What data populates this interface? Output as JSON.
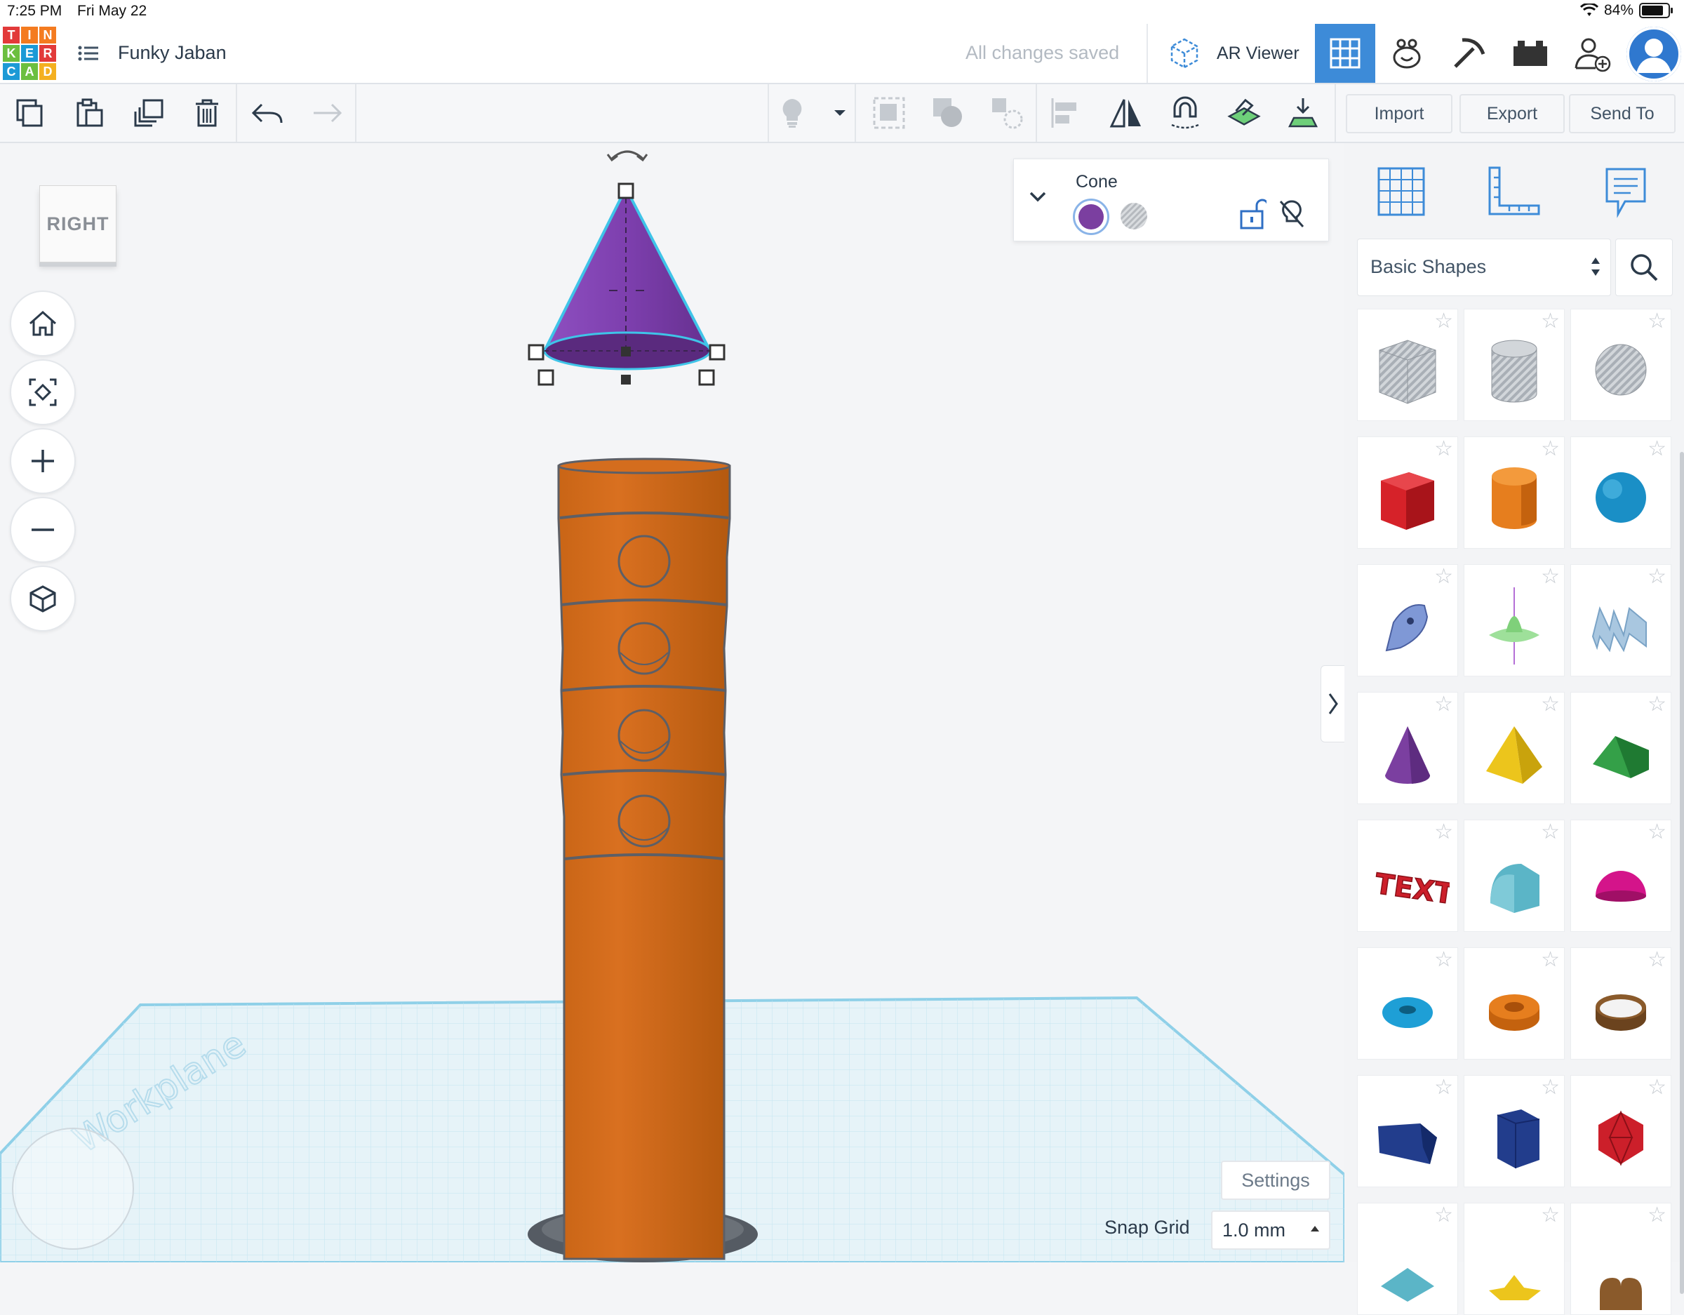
{
  "status_bar": {
    "time": "7:25 PM",
    "date": "Fri May 22",
    "battery": "84%"
  },
  "header": {
    "logo_letters": [
      "T",
      "I",
      "N",
      "K",
      "E",
      "R",
      "C",
      "A",
      "D"
    ],
    "logo_colors": [
      "#e23a3a",
      "#f47b20",
      "#f47b20",
      "#6cbf3f",
      "#1c9ad6",
      "#e23a3a",
      "#1c9ad6",
      "#6cbf3f",
      "#f4b020"
    ],
    "doc_title": "Funky Jaban",
    "save_status": "All changes saved",
    "ar_viewer_label": "AR Viewer",
    "view_buttons": [
      "grid-view-icon",
      "blocks-view-icon",
      "bricks-view-icon",
      "sim-lab-icon"
    ],
    "active_view": "grid-view-icon"
  },
  "toolbar": {
    "left_tools": [
      "copy-icon",
      "paste-icon",
      "duplicate-icon",
      "delete-icon",
      "undo-icon",
      "redo-icon"
    ],
    "right_tools": [
      "light-bulb-icon",
      "dropdown-icon",
      "group-icon",
      "ungroup-icon",
      "hole-icon",
      "align-icon",
      "mirror-icon",
      "magnet-icon",
      "workplane-icon",
      "drop-icon"
    ],
    "import_label": "Import",
    "export_label": "Export",
    "send_to_label": "Send To"
  },
  "viewport": {
    "view_cube_label": "RIGHT",
    "nav_buttons": [
      "home-view-icon",
      "fit-view-icon",
      "zoom-in-icon",
      "zoom-out-icon",
      "perspective-icon"
    ],
    "workplane_label": "Workplane",
    "selected_object_color": "#7b3fa0",
    "tower_color": "#d06a1c"
  },
  "inspector": {
    "title": "Cone",
    "solid_color": "#7b3fa0",
    "hole_option": "hole"
  },
  "settings": {
    "settings_label": "Settings",
    "snap_grid_label": "Snap Grid",
    "snap_grid_value": "1.0 mm"
  },
  "shape_panel": {
    "category": "Basic Shapes",
    "shapes": [
      {
        "name": "box-hole",
        "color": "#b9bec4"
      },
      {
        "name": "cylinder-hole",
        "color": "#b9bec4"
      },
      {
        "name": "sphere-hole",
        "color": "#b9bec4"
      },
      {
        "name": "box",
        "color": "#d62229"
      },
      {
        "name": "cylinder",
        "color": "#e67e1e"
      },
      {
        "name": "sphere",
        "color": "#1a8fc6"
      },
      {
        "name": "scribble",
        "color": "#7f98d6"
      },
      {
        "name": "shape-generator",
        "color": "#9ee09a"
      },
      {
        "name": "text-hole",
        "color": "#a9c7e0"
      },
      {
        "name": "cone",
        "color": "#7b3fa0"
      },
      {
        "name": "pyramid",
        "color": "#ecc51c"
      },
      {
        "name": "roof",
        "color": "#34a048"
      },
      {
        "name": "text",
        "color": "#cc1f2a"
      },
      {
        "name": "half-cylinder",
        "color": "#5bb5c7"
      },
      {
        "name": "half-sphere",
        "color": "#d4148a"
      },
      {
        "name": "torus",
        "color": "#1e9fd6"
      },
      {
        "name": "tube",
        "color": "#e67e1e"
      },
      {
        "name": "ring",
        "color": "#8a5a2b"
      },
      {
        "name": "wedge",
        "color": "#223d8c"
      },
      {
        "name": "polygon",
        "color": "#223d8c"
      },
      {
        "name": "icosahedron",
        "color": "#cc1f2a"
      },
      {
        "name": "diamond",
        "color": "#5bb5c7"
      },
      {
        "name": "star",
        "color": "#ecc51c"
      },
      {
        "name": "heart",
        "color": "#8a5a2b"
      }
    ]
  }
}
